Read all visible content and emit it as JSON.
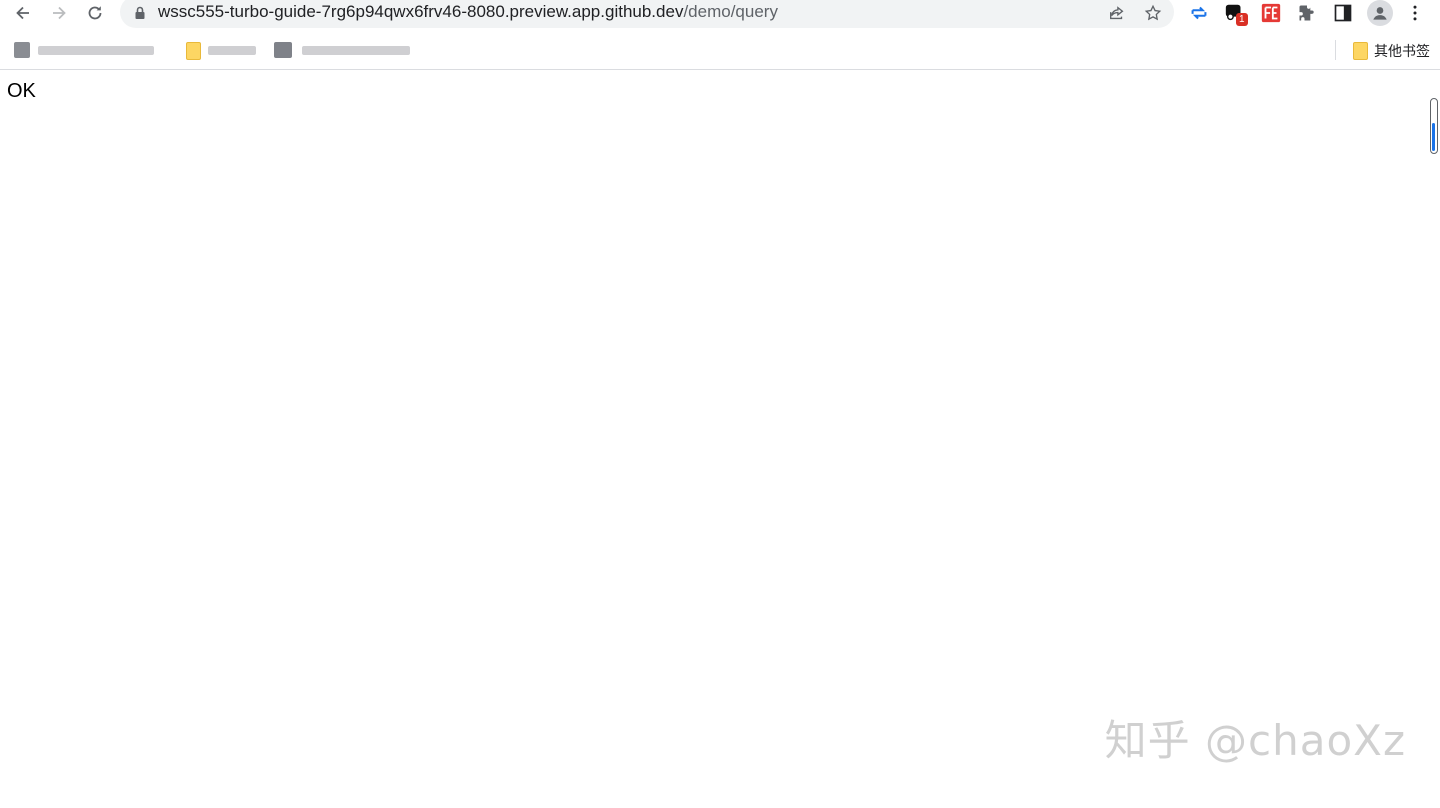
{
  "browser": {
    "url_host": "wssc555-turbo-guide-7rg6p94qwx6frv46-8080.preview.app.github.dev",
    "url_path": "/demo/query",
    "extension_badge": "1",
    "icons": [
      "back-icon",
      "forward-icon",
      "reload-icon",
      "lock-icon",
      "share-icon",
      "star-icon",
      "sync-icon",
      "extension-icon",
      "puzzle-icon",
      "side-panel-icon",
      "profile-icon",
      "menu-icon"
    ]
  },
  "bookmarks": {
    "other_label": "其他书签"
  },
  "page": {
    "body_text": "OK"
  },
  "watermark": "知乎 @chaoXz",
  "colors": {
    "accent": "#1a73e8",
    "folder": "#fdd663",
    "omnibox": "#f1f3f4"
  }
}
